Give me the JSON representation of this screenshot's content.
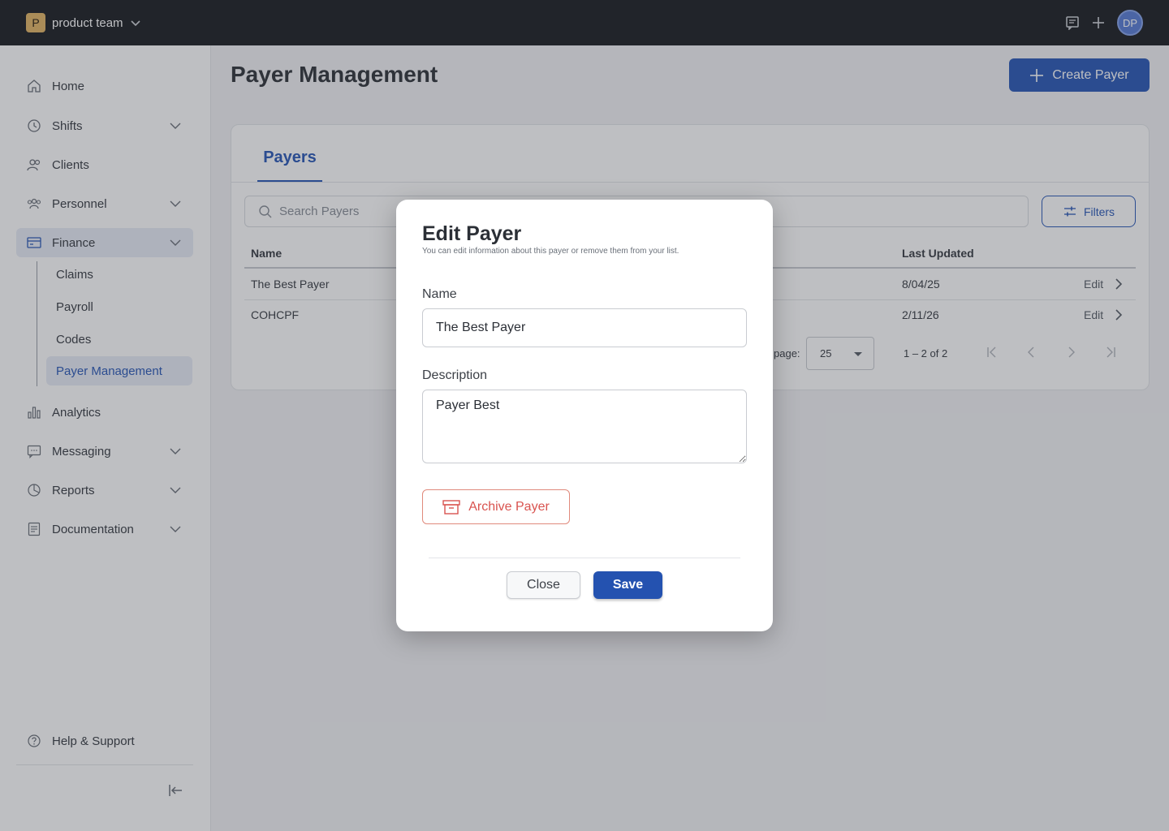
{
  "topbar": {
    "team_initial": "P",
    "team_name": "product team",
    "avatar_initials": "DP"
  },
  "sidebar": {
    "items": [
      {
        "label": "Home",
        "icon": "home-icon",
        "expandable": false
      },
      {
        "label": "Shifts",
        "icon": "shifts-clock-icon",
        "expandable": true
      },
      {
        "label": "Clients",
        "icon": "clients-icon",
        "expandable": false
      },
      {
        "label": "Personnel",
        "icon": "personnel-icon",
        "expandable": true
      },
      {
        "label": "Finance",
        "icon": "finance-card-icon",
        "expandable": true,
        "active": true
      },
      {
        "label": "Analytics",
        "icon": "analytics-chart-icon",
        "expandable": false
      },
      {
        "label": "Messaging",
        "icon": "messaging-icon",
        "expandable": true
      },
      {
        "label": "Reports",
        "icon": "reports-pie-icon",
        "expandable": true
      },
      {
        "label": "Documentation",
        "icon": "documentation-icon",
        "expandable": true
      }
    ],
    "finance_sub": [
      {
        "label": "Claims"
      },
      {
        "label": "Payroll"
      },
      {
        "label": "Codes"
      },
      {
        "label": "Payer Management",
        "active": true
      }
    ],
    "help_label": "Help & Support"
  },
  "main": {
    "title": "Payer Management",
    "create_button": "Create Payer",
    "tab_label": "Payers",
    "search_placeholder": "Search Payers",
    "filters_label": "Filters",
    "columns": {
      "name": "Name",
      "last_updated": "Last Updated"
    },
    "rows": [
      {
        "name": "The Best Payer",
        "last_updated": "8/04/25",
        "action": "Edit"
      },
      {
        "name": "COHCPF",
        "last_updated": "2/11/26",
        "action": "Edit"
      }
    ],
    "pagination": {
      "per_page_label": "page:",
      "per_page_value": "25",
      "range": "1 – 2 of 2"
    }
  },
  "modal": {
    "title": "Edit Payer",
    "subtitle": "You can edit information about this payer or remove them from your list.",
    "name_label": "Name",
    "name_value": "The Best Payer",
    "description_label": "Description",
    "description_value": "Payer Best",
    "archive_label": "Archive Payer",
    "close_label": "Close",
    "save_label": "Save"
  },
  "colors": {
    "primary": "#2d5bb8",
    "danger": "#d9534f",
    "topbar": "#1f2226",
    "team_logo": "#e3b768"
  }
}
